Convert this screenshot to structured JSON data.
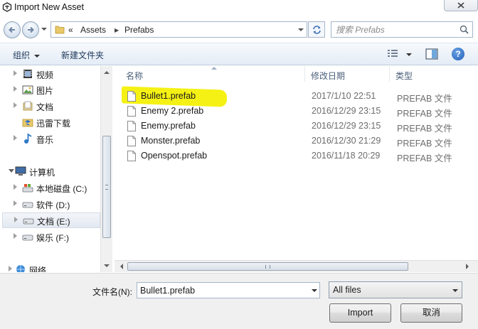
{
  "window": {
    "title": "Import New Asset"
  },
  "address": {
    "overflow": "«",
    "segments": [
      "Assets",
      "Prefabs"
    ],
    "separator": "▶"
  },
  "search": {
    "placeholder": "搜索 Prefabs"
  },
  "toolbar": {
    "organize_label": "组织",
    "new_folder_label": "新建文件夹",
    "help_label": "?"
  },
  "nav": {
    "items": [
      {
        "label": "视频",
        "icon": "video-library-icon",
        "state": "collapsed"
      },
      {
        "label": "图片",
        "icon": "picture-library-icon",
        "state": "collapsed"
      },
      {
        "label": "文档",
        "icon": "document-library-icon",
        "state": "collapsed"
      },
      {
        "label": "迅雷下载",
        "icon": "thunder-download-icon",
        "state": "none"
      },
      {
        "label": "音乐",
        "icon": "music-library-icon",
        "state": "collapsed"
      },
      {
        "label": "计算机",
        "icon": "computer-icon",
        "state": "expanded"
      },
      {
        "label": "本地磁盘 (C:)",
        "icon": "system-drive-icon",
        "state": "collapsed"
      },
      {
        "label": "软件 (D:)",
        "icon": "drive-icon",
        "state": "collapsed"
      },
      {
        "label": "文档 (E:)",
        "icon": "drive-icon",
        "state": "collapsed",
        "selected": true
      },
      {
        "label": "娱乐 (F:)",
        "icon": "drive-icon",
        "state": "collapsed"
      },
      {
        "label": "网络",
        "icon": "network-icon",
        "state": "collapsed"
      }
    ]
  },
  "columns": {
    "name": "名称",
    "date": "修改日期",
    "type": "类型"
  },
  "files": [
    {
      "name": "Bullet1.prefab",
      "date": "2017/1/10 22:51",
      "type": "PREFAB 文件",
      "highlighted": true
    },
    {
      "name": "Enemy 2.prefab",
      "date": "2016/12/29 23:15",
      "type": "PREFAB 文件"
    },
    {
      "name": "Enemy.prefab",
      "date": "2016/12/29 23:15",
      "type": "PREFAB 文件"
    },
    {
      "name": "Monster.prefab",
      "date": "2016/12/30 21:29",
      "type": "PREFAB 文件"
    },
    {
      "name": "Openspot.prefab",
      "date": "2016/11/18 20:29",
      "type": "PREFAB 文件"
    }
  ],
  "bottom": {
    "filename_label": "文件名(N):",
    "filename_value": "Bullet1.prefab",
    "filter_value": "All files",
    "import_label": "Import",
    "cancel_label": "取消"
  },
  "colors": {
    "highlight": "#f4f000",
    "link_text": "#1e395b",
    "column_header": "#4c607a"
  }
}
